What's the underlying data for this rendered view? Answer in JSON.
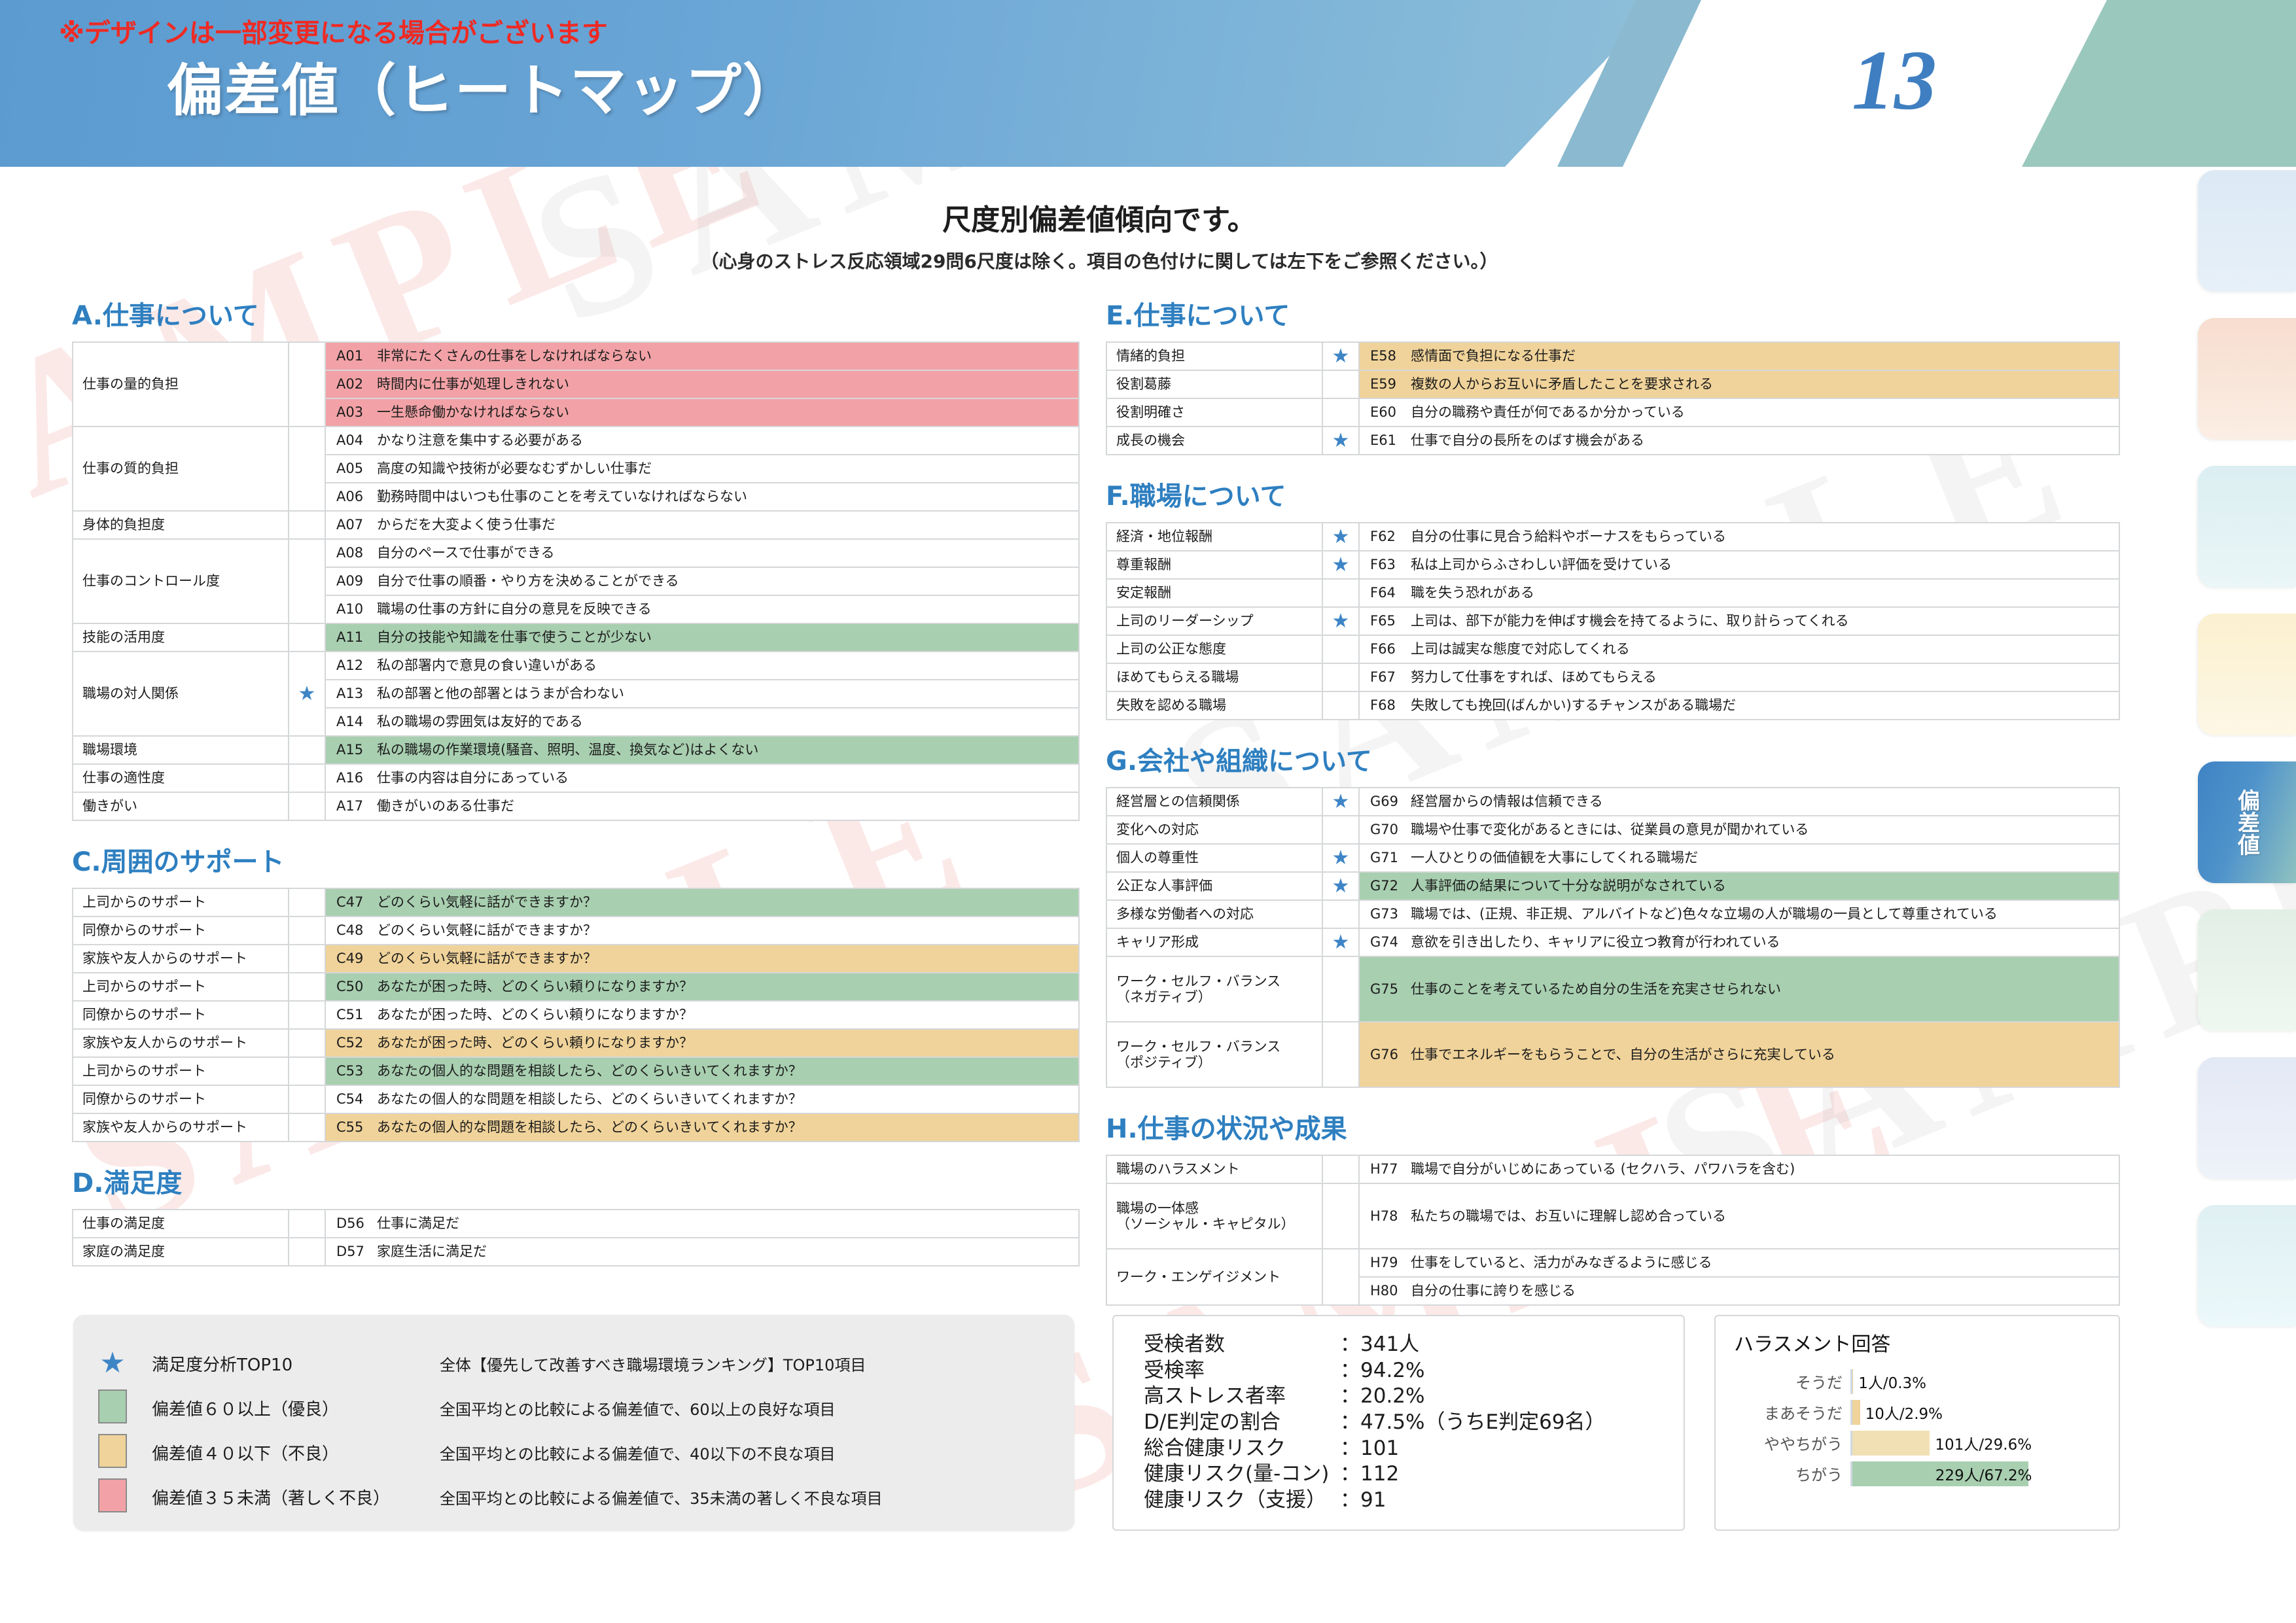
{
  "header": {
    "note": "※デザインは一部変更になる場合がございます",
    "title": "偏差値（ヒートマップ）",
    "page_number": "13",
    "accent_blue": "#5b9bd0",
    "accent_green": "#9bc8bd",
    "note_color": "#ee2a24"
  },
  "tabs": {
    "active_label": "偏差値"
  },
  "subtitle": {
    "main": "尺度別偏差値傾向です。",
    "note": "（心身のストレス反応領域29問6尺度は除く。項目の色付けに関しては左下をご参照ください。）"
  },
  "sections": [
    {
      "id": "A",
      "title": "A.仕事について",
      "rows": [
        {
          "label": "仕事の量的負担",
          "rowspan": 3,
          "star": false,
          "code": "A01",
          "text": "非常にたくさんの仕事をしなければならない",
          "color": "red"
        },
        {
          "label": "",
          "rowspan": 0,
          "star": false,
          "code": "A02",
          "text": "時間内に仕事が処理しきれない",
          "color": "red"
        },
        {
          "label": "",
          "rowspan": 0,
          "star": false,
          "code": "A03",
          "text": "一生懸命働かなければならない",
          "color": "red"
        },
        {
          "label": "仕事の質的負担",
          "rowspan": 3,
          "star": false,
          "code": "A04",
          "text": "かなり注意を集中する必要がある",
          "color": "none"
        },
        {
          "label": "",
          "rowspan": 0,
          "star": false,
          "code": "A05",
          "text": "高度の知識や技術が必要なむずかしい仕事だ",
          "color": "none"
        },
        {
          "label": "",
          "rowspan": 0,
          "star": false,
          "code": "A06",
          "text": "勤務時間中はいつも仕事のことを考えていなければならない",
          "color": "none"
        },
        {
          "label": "身体的負担度",
          "rowspan": 1,
          "star": false,
          "code": "A07",
          "text": "からだを大変よく使う仕事だ",
          "color": "none"
        },
        {
          "label": "仕事のコントロール度",
          "rowspan": 3,
          "star": false,
          "code": "A08",
          "text": "自分のペースで仕事ができる",
          "color": "none"
        },
        {
          "label": "",
          "rowspan": 0,
          "star": false,
          "code": "A09",
          "text": "自分で仕事の順番・やり方を決めることができる",
          "color": "none"
        },
        {
          "label": "",
          "rowspan": 0,
          "star": false,
          "code": "A10",
          "text": "職場の仕事の方針に自分の意見を反映できる",
          "color": "none"
        },
        {
          "label": "技能の活用度",
          "rowspan": 1,
          "star": false,
          "code": "A11",
          "text": "自分の技能や知識を仕事で使うことが少ない",
          "color": "green"
        },
        {
          "label": "職場の対人関係",
          "rowspan": 3,
          "star": true,
          "code": "A12",
          "text": "私の部署内で意見の食い違いがある",
          "color": "none"
        },
        {
          "label": "",
          "rowspan": 0,
          "star": false,
          "code": "A13",
          "text": "私の部署と他の部署とはうまが合わない",
          "color": "none"
        },
        {
          "label": "",
          "rowspan": 0,
          "star": false,
          "code": "A14",
          "text": "私の職場の雰囲気は友好的である",
          "color": "none"
        },
        {
          "label": "職場環境",
          "rowspan": 1,
          "star": false,
          "code": "A15",
          "text": "私の職場の作業環境(騒音、照明、温度、換気など)はよくない",
          "color": "green"
        },
        {
          "label": "仕事の適性度",
          "rowspan": 1,
          "star": false,
          "code": "A16",
          "text": "仕事の内容は自分にあっている",
          "color": "none"
        },
        {
          "label": "働きがい",
          "rowspan": 1,
          "star": false,
          "code": "A17",
          "text": "働きがいのある仕事だ",
          "color": "none"
        }
      ]
    },
    {
      "id": "C",
      "title": "C.周囲のサポート",
      "rows": [
        {
          "label": "上司からのサポート",
          "rowspan": 1,
          "star": false,
          "code": "C47",
          "text": "どのくらい気軽に話ができますか？",
          "color": "green"
        },
        {
          "label": "同僚からのサポート",
          "rowspan": 1,
          "star": false,
          "code": "C48",
          "text": "どのくらい気軽に話ができますか？",
          "color": "none"
        },
        {
          "label": "家族や友人からのサポート",
          "rowspan": 1,
          "star": false,
          "code": "C49",
          "text": "どのくらい気軽に話ができますか？",
          "color": "orange"
        },
        {
          "label": "上司からのサポート",
          "rowspan": 1,
          "star": false,
          "code": "C50",
          "text": "あなたが困った時、どのくらい頼りになりますか？",
          "color": "green"
        },
        {
          "label": "同僚からのサポート",
          "rowspan": 1,
          "star": false,
          "code": "C51",
          "text": "あなたが困った時、どのくらい頼りになりますか？",
          "color": "none"
        },
        {
          "label": "家族や友人からのサポート",
          "rowspan": 1,
          "star": false,
          "code": "C52",
          "text": "あなたが困った時、どのくらい頼りになりますか？",
          "color": "orange"
        },
        {
          "label": "上司からのサポート",
          "rowspan": 1,
          "star": false,
          "code": "C53",
          "text": "あなたの個人的な問題を相談したら、どのくらいきいてくれますか？",
          "color": "green"
        },
        {
          "label": "同僚からのサポート",
          "rowspan": 1,
          "star": false,
          "code": "C54",
          "text": "あなたの個人的な問題を相談したら、どのくらいきいてくれますか？",
          "color": "none"
        },
        {
          "label": "家族や友人からのサポート",
          "rowspan": 1,
          "star": false,
          "code": "C55",
          "text": "あなたの個人的な問題を相談したら、どのくらいきいてくれますか？",
          "color": "orange"
        }
      ]
    },
    {
      "id": "D",
      "title": "D.満足度",
      "rows": [
        {
          "label": "仕事の満足度",
          "rowspan": 1,
          "star": false,
          "code": "D56",
          "text": "仕事に満足だ",
          "color": "none"
        },
        {
          "label": "家庭の満足度",
          "rowspan": 1,
          "star": false,
          "code": "D57",
          "text": "家庭生活に満足だ",
          "color": "none"
        }
      ]
    },
    {
      "id": "E",
      "title": "E.仕事について",
      "rows": [
        {
          "label": "情緒的負担",
          "rowspan": 1,
          "star": true,
          "code": "E58",
          "text": "感情面で負担になる仕事だ",
          "color": "orange"
        },
        {
          "label": "役割葛藤",
          "rowspan": 1,
          "star": false,
          "code": "E59",
          "text": "複数の人からお互いに矛盾したことを要求される",
          "color": "orange"
        },
        {
          "label": "役割明確さ",
          "rowspan": 1,
          "star": false,
          "code": "E60",
          "text": "自分の職務や責任が何であるか分かっている",
          "color": "none"
        },
        {
          "label": "成長の機会",
          "rowspan": 1,
          "star": true,
          "code": "E61",
          "text": "仕事で自分の長所をのばす機会がある",
          "color": "none"
        }
      ]
    },
    {
      "id": "F",
      "title": "F.職場について",
      "rows": [
        {
          "label": "経済・地位報酬",
          "rowspan": 1,
          "star": true,
          "code": "F62",
          "text": "自分の仕事に見合う給料やボーナスをもらっている",
          "color": "none"
        },
        {
          "label": "尊重報酬",
          "rowspan": 1,
          "star": true,
          "code": "F63",
          "text": "私は上司からふさわしい評価を受けている",
          "color": "none"
        },
        {
          "label": "安定報酬",
          "rowspan": 1,
          "star": false,
          "code": "F64",
          "text": "職を失う恐れがある",
          "color": "none"
        },
        {
          "label": "上司のリーダーシップ",
          "rowspan": 1,
          "star": true,
          "code": "F65",
          "text": "上司は、部下が能力を伸ばす機会を持てるように、取り計らってくれる",
          "color": "none"
        },
        {
          "label": "上司の公正な態度",
          "rowspan": 1,
          "star": false,
          "code": "F66",
          "text": "上司は誠実な態度で対応してくれる",
          "color": "none"
        },
        {
          "label": "ほめてもらえる職場",
          "rowspan": 1,
          "star": false,
          "code": "F67",
          "text": "努力して仕事をすれば、ほめてもらえる",
          "color": "none"
        },
        {
          "label": "失敗を認める職場",
          "rowspan": 1,
          "star": false,
          "code": "F68",
          "text": "失敗しても挽回(ばんかい)するチャンスがある職場だ",
          "color": "none"
        }
      ]
    },
    {
      "id": "G",
      "title": "G.会社や組織について",
      "rows": [
        {
          "label": "経営層との信頼関係",
          "rowspan": 1,
          "star": true,
          "code": "G69",
          "text": "経営層からの情報は信頼できる",
          "color": "none"
        },
        {
          "label": "変化への対応",
          "rowspan": 1,
          "star": false,
          "code": "G70",
          "text": "職場や仕事で変化があるときには、従業員の意見が聞かれている",
          "color": "none"
        },
        {
          "label": "個人の尊重性",
          "rowspan": 1,
          "star": true,
          "code": "G71",
          "text": "一人ひとりの価値観を大事にしてくれる職場だ",
          "color": "none"
        },
        {
          "label": "公正な人事評価",
          "rowspan": 1,
          "star": true,
          "code": "G72",
          "text": "人事評価の結果について十分な説明がなされている",
          "color": "green"
        },
        {
          "label": "多様な労働者への対応",
          "rowspan": 1,
          "star": false,
          "code": "G73",
          "text": "職場では、(正規、非正規、アルバイトなど)色々な立場の人が職場の一員として尊重されている",
          "color": "none"
        },
        {
          "label": "キャリア形成",
          "rowspan": 1,
          "star": true,
          "code": "G74",
          "text": "意欲を引き出したり、キャリアに役立つ教育が行われている",
          "color": "none"
        },
        {
          "label": "ワーク・セルフ・バランス\n（ネガティブ）",
          "rowspan": 1,
          "star": false,
          "code": "G75",
          "text": "仕事のことを考えているため自分の生活を充実させられない",
          "color": "green",
          "tall": true
        },
        {
          "label": "ワーク・セルフ・バランス\n（ポジティブ）",
          "rowspan": 1,
          "star": false,
          "code": "G76",
          "text": "仕事でエネルギーをもらうことで、自分の生活がさらに充実している",
          "color": "orange",
          "tall": true
        }
      ]
    },
    {
      "id": "H",
      "title": "H.仕事の状況や成果",
      "rows": [
        {
          "label": "職場のハラスメント",
          "rowspan": 1,
          "star": false,
          "code": "H77",
          "text": "職場で自分がいじめにあっている (セクハラ、パワハラを含む)",
          "color": "none"
        },
        {
          "label": "職場の一体感\n（ソーシャル・キャピタル）",
          "rowspan": 1,
          "star": false,
          "code": "H78",
          "text": "私たちの職場では、お互いに理解し認め合っている",
          "color": "none",
          "tall": true
        },
        {
          "label": "ワーク・エンゲイジメント",
          "rowspan": 2,
          "star": false,
          "code": "H79",
          "text": "仕事をしていると、活力がみなぎるように感じる",
          "color": "none"
        },
        {
          "label": "",
          "rowspan": 0,
          "star": false,
          "code": "H80",
          "text": "自分の仕事に誇りを感じる",
          "color": "none"
        }
      ]
    }
  ],
  "legend": {
    "items": [
      {
        "mark": "star",
        "name": "満足度分析TOP10",
        "desc": "全体【優先して改善すべき職場環境ランキング】TOP10項目",
        "color": "#3e85c6"
      },
      {
        "mark": "swatch",
        "name": "偏差値６０以上（優良）",
        "desc": "全国平均との比較による偏差値で、60以上の良好な項目",
        "color": "#a8cfb0"
      },
      {
        "mark": "swatch",
        "name": "偏差値４０以下（不良）",
        "desc": "全国平均との比較による偏差値で、40以下の不良な項目",
        "color": "#f0d39a"
      },
      {
        "mark": "swatch",
        "name": "偏差値３５未満（著しく不良）",
        "desc": "全国平均との比較による偏差値で、35未満の著しく不良な項目",
        "color": "#f2a2a6"
      }
    ]
  },
  "stats": {
    "rows": [
      {
        "key": "受検者数",
        "value": "：341人"
      },
      {
        "key": "受検率",
        "value": "：94.2%"
      },
      {
        "key": "高ストレス者率",
        "value": "：20.2%"
      },
      {
        "key": "D/E判定の割合",
        "value": "：47.5%（うちE判定69名）"
      },
      {
        "key": "総合健康リスク",
        "value": "：101"
      },
      {
        "key": "健康リスク(量-コン)",
        "value": "：112"
      },
      {
        "key": "健康リスク（支援）",
        "value": "：91"
      }
    ]
  },
  "chart_data": {
    "type": "bar",
    "title": "ハラスメント回答",
    "orientation": "horizontal",
    "categories": [
      "そうだ",
      "まあそうだ",
      "ややちがう",
      "ちがう"
    ],
    "values": [
      0.3,
      2.9,
      29.6,
      67.2
    ],
    "counts": [
      1,
      10,
      101,
      229
    ],
    "labels": [
      "1人/0.3%",
      "10人/2.9%",
      "101人/29.6%",
      "229人/67.2%"
    ],
    "colors": [
      "#f0d39a",
      "#f0d39a",
      "#f0e0b4",
      "#a8cfb0"
    ],
    "xlabel": "",
    "ylabel": "",
    "xlim": [
      0,
      75
    ],
    "grid": false,
    "legend": "none"
  }
}
